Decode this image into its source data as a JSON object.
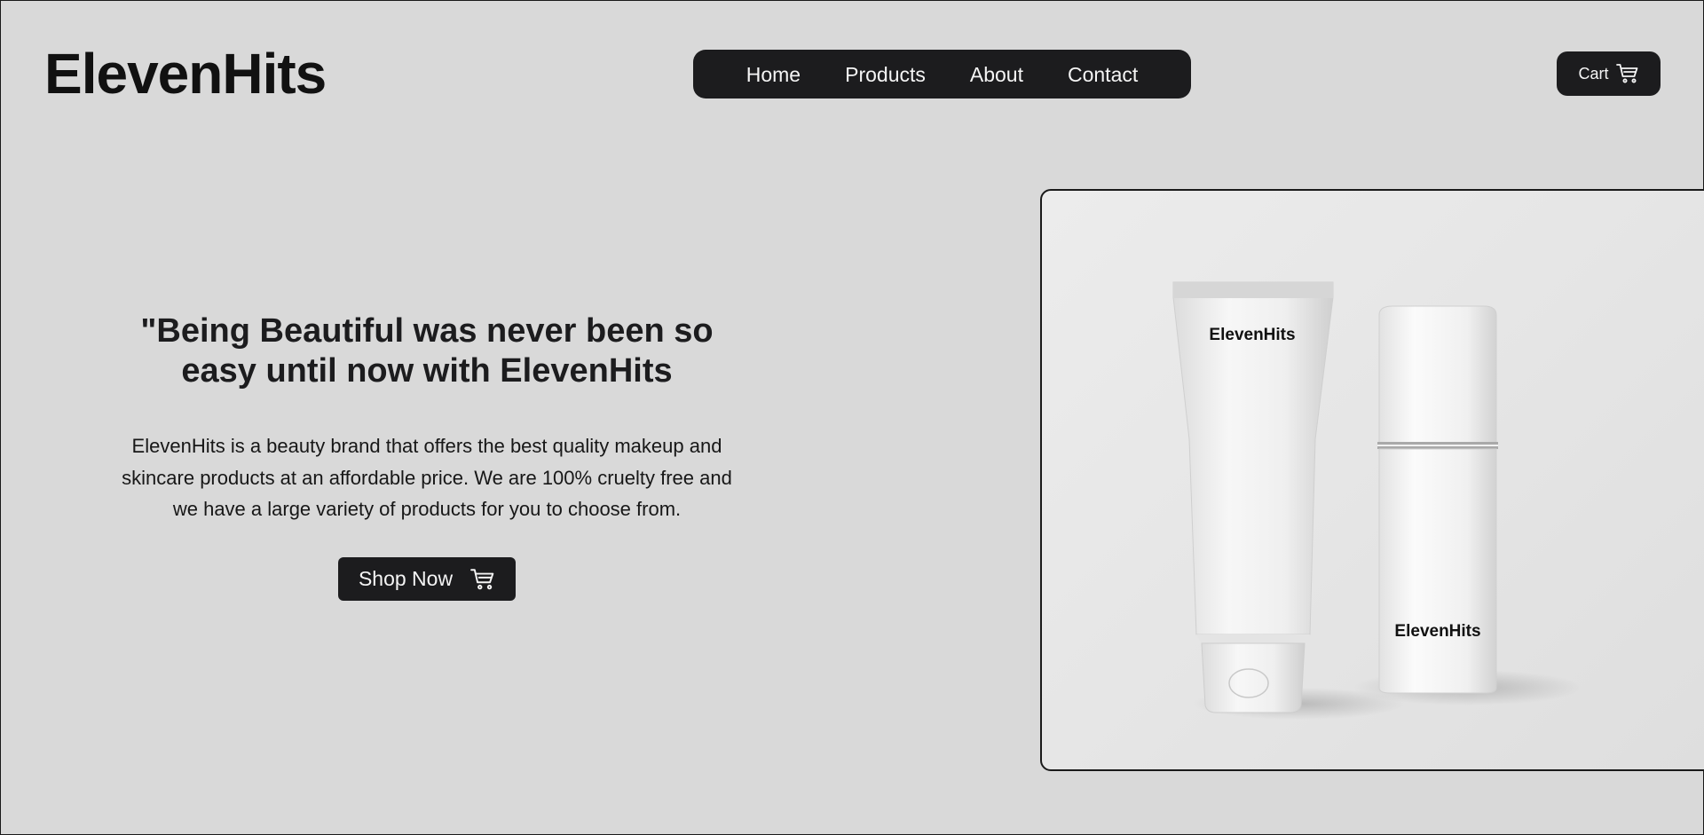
{
  "header": {
    "brand": "ElevenHits",
    "nav": [
      {
        "label": "Home"
      },
      {
        "label": "Products"
      },
      {
        "label": "About"
      },
      {
        "label": "Contact"
      }
    ],
    "cart_label": "Cart",
    "cart_icon": "cart-icon"
  },
  "hero": {
    "title_line1": "\"Being Beautiful was never been so",
    "title_line2": "easy until now with ElevenHits",
    "description_line1": "ElevenHits is a beauty brand that offers the best quality makeup and",
    "description_line2": "skincare products at an affordable price. We are 100% cruelty free and",
    "description_line3": "we have a large variety of products for you to choose from.",
    "cta_label": "Shop Now",
    "cta_icon": "cart-icon"
  },
  "product_image": {
    "tube_label": "ElevenHits",
    "bottle_label": "ElevenHits"
  },
  "colors": {
    "background": "#d9d9d9",
    "dark": "#1c1c1e",
    "light_text": "#f5f5f5"
  }
}
